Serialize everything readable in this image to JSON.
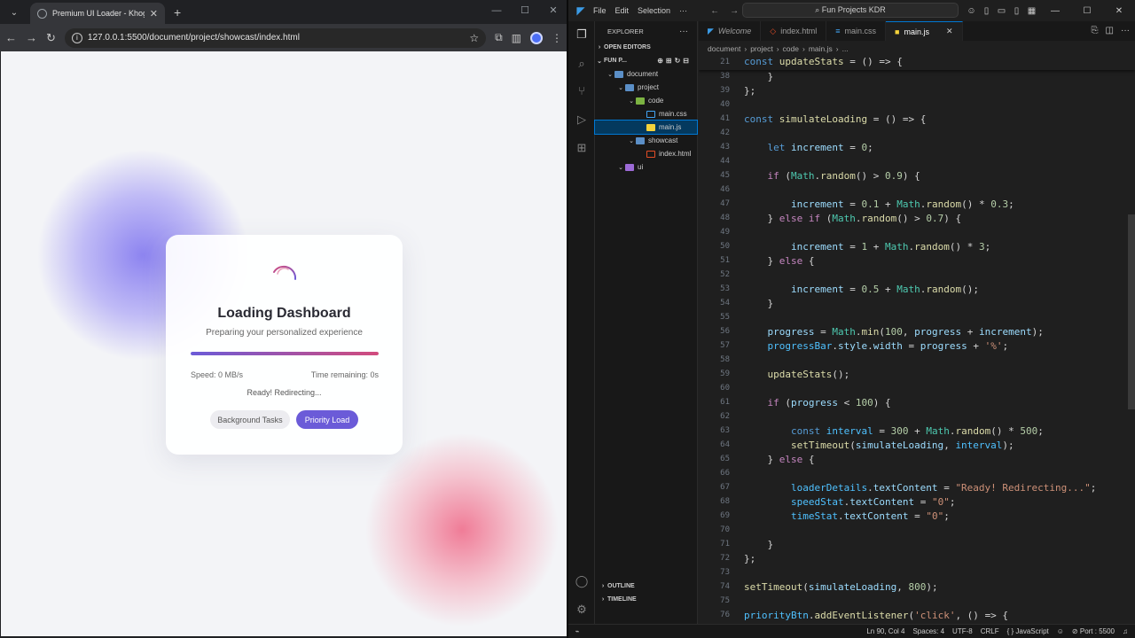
{
  "browser": {
    "tab_title": "Premium UI Loader - Khogendr",
    "url": "127.0.0.1:5500/document/project/showcast/index.html"
  },
  "loader": {
    "title": "Loading Dashboard",
    "subtitle": "Preparing your personalized experience",
    "progress_percent": 100,
    "speed": "Speed: 0 MB/s",
    "time_remaining": "Time remaining: 0s",
    "details": "Ready! Redirecting...",
    "btn_background": "Background Tasks",
    "btn_priority": "Priority Load",
    "accent": "#6b5bd8",
    "accent2": "#d24b7c"
  },
  "vscode": {
    "menu": [
      "File",
      "Edit",
      "Selection",
      "···"
    ],
    "command_center": "Fun Projects KDR",
    "explorer_title": "EXPLORER",
    "open_editors": "OPEN EDITORS",
    "workspace": "FUN P...",
    "tree": [
      {
        "label": "document",
        "type": "folder",
        "depth": 1,
        "open": true
      },
      {
        "label": "project",
        "type": "folder",
        "depth": 2,
        "open": true
      },
      {
        "label": "code",
        "type": "folder-g",
        "depth": 3,
        "open": true
      },
      {
        "label": "main.css",
        "type": "css",
        "depth": 4
      },
      {
        "label": "main.js",
        "type": "js",
        "depth": 4,
        "selected": true
      },
      {
        "label": "showcast",
        "type": "folder",
        "depth": 3,
        "open": true
      },
      {
        "label": "index.html",
        "type": "html",
        "depth": 4
      },
      {
        "label": "ui",
        "type": "folder-u",
        "depth": 2,
        "open": true
      }
    ],
    "outline": "OUTLINE",
    "timeline": "TIMELINE",
    "tabs": [
      {
        "label": "Welcome",
        "icon": "vscode-icon"
      },
      {
        "label": "index.html",
        "icon": "html-icon"
      },
      {
        "label": "main.css",
        "icon": "css-icon"
      },
      {
        "label": "main.js",
        "icon": "js-icon",
        "active": true
      }
    ],
    "breadcrumbs": [
      "document",
      "project",
      "code",
      "main.js",
      "..."
    ],
    "code_lines": [
      {
        "n": "21",
        "html": "<span class='st'>const</span> <span class='fn'>updateStats</span> <span class='op'>=</span> () <span class='op'>=&gt;</span> {"
      },
      {
        "n": "38",
        "html": "    }"
      },
      {
        "n": "39",
        "html": "};"
      },
      {
        "n": "40",
        "html": ""
      },
      {
        "n": "41",
        "html": "<span class='st'>const</span> <span class='fn'>simulateLoading</span> <span class='op'>=</span> () <span class='op'>=&gt;</span> {"
      },
      {
        "n": "42",
        "html": ""
      },
      {
        "n": "43",
        "html": "    <span class='st'>let</span> <span class='vr'>increment</span> <span class='op'>=</span> <span class='nm'>0</span>;"
      },
      {
        "n": "44",
        "html": ""
      },
      {
        "n": "45",
        "html": "    <span class='kw'>if</span> (<span class='ty'>Math</span>.<span class='fn'>random</span>() <span class='op'>&gt;</span> <span class='nm'>0.9</span>) {"
      },
      {
        "n": "46",
        "html": ""
      },
      {
        "n": "47",
        "html": "        <span class='vr'>increment</span> <span class='op'>=</span> <span class='nm'>0.1</span> <span class='op'>+</span> <span class='ty'>Math</span>.<span class='fn'>random</span>() <span class='op'>*</span> <span class='nm'>0.3</span>;"
      },
      {
        "n": "48",
        "html": "    } <span class='kw'>else if</span> (<span class='ty'>Math</span>.<span class='fn'>random</span>() <span class='op'>&gt;</span> <span class='nm'>0.7</span>) {"
      },
      {
        "n": "49",
        "html": ""
      },
      {
        "n": "50",
        "html": "        <span class='vr'>increment</span> <span class='op'>=</span> <span class='nm'>1</span> <span class='op'>+</span> <span class='ty'>Math</span>.<span class='fn'>random</span>() <span class='op'>*</span> <span class='nm'>3</span>;"
      },
      {
        "n": "51",
        "html": "    } <span class='kw'>else</span> {"
      },
      {
        "n": "52",
        "html": ""
      },
      {
        "n": "53",
        "html": "        <span class='vr'>increment</span> <span class='op'>=</span> <span class='nm'>0.5</span> <span class='op'>+</span> <span class='ty'>Math</span>.<span class='fn'>random</span>();"
      },
      {
        "n": "54",
        "html": "    }"
      },
      {
        "n": "55",
        "html": ""
      },
      {
        "n": "56",
        "html": "    <span class='vr'>progress</span> <span class='op'>=</span> <span class='ty'>Math</span>.<span class='fn'>min</span>(<span class='nm'>100</span>, <span class='vr'>progress</span> <span class='op'>+</span> <span class='vr'>increment</span>);"
      },
      {
        "n": "57",
        "html": "    <span class='cn'>progressBar</span>.<span class='vr'>style</span>.<span class='vr'>width</span> <span class='op'>=</span> <span class='vr'>progress</span> <span class='op'>+</span> <span class='sg'>'%'</span>;"
      },
      {
        "n": "58",
        "html": ""
      },
      {
        "n": "59",
        "html": "    <span class='fn'>updateStats</span>();"
      },
      {
        "n": "60",
        "html": ""
      },
      {
        "n": "61",
        "html": "    <span class='kw'>if</span> (<span class='vr'>progress</span> <span class='op'>&lt;</span> <span class='nm'>100</span>) {"
      },
      {
        "n": "62",
        "html": ""
      },
      {
        "n": "63",
        "html": "        <span class='st'>const</span> <span class='cn'>interval</span> <span class='op'>=</span> <span class='nm'>300</span> <span class='op'>+</span> <span class='ty'>Math</span>.<span class='fn'>random</span>() <span class='op'>*</span> <span class='nm'>500</span>;"
      },
      {
        "n": "64",
        "html": "        <span class='fn'>setTimeout</span>(<span class='vr'>simulateLoading</span>, <span class='cn'>interval</span>);"
      },
      {
        "n": "65",
        "html": "    } <span class='kw'>else</span> {"
      },
      {
        "n": "66",
        "html": ""
      },
      {
        "n": "67",
        "html": "        <span class='cn'>loaderDetails</span>.<span class='vr'>textContent</span> <span class='op'>=</span> <span class='sg'>\"Ready! Redirecting...\"</span>;"
      },
      {
        "n": "68",
        "html": "        <span class='cn'>speedStat</span>.<span class='vr'>textContent</span> <span class='op'>=</span> <span class='sg'>\"0\"</span>;"
      },
      {
        "n": "69",
        "html": "        <span class='cn'>timeStat</span>.<span class='vr'>textContent</span> <span class='op'>=</span> <span class='sg'>\"0\"</span>;"
      },
      {
        "n": "70",
        "html": ""
      },
      {
        "n": "71",
        "html": "    }"
      },
      {
        "n": "72",
        "html": "};"
      },
      {
        "n": "73",
        "html": ""
      },
      {
        "n": "74",
        "html": "<span class='fn'>setTimeout</span>(<span class='vr'>simulateLoading</span>, <span class='nm'>800</span>);"
      },
      {
        "n": "75",
        "html": ""
      },
      {
        "n": "76",
        "html": "<span class='cn'>priorityBtn</span>.<span class='fn'>addEventListener</span>(<span class='sg'>'click'</span>, () <span class='op'>=&gt;</span> {"
      }
    ],
    "status": {
      "position": "Ln 90, Col 4",
      "spaces": "Spaces: 4",
      "encoding": "UTF-8",
      "eol": "CRLF",
      "language": "{ } JavaScript",
      "port": "Port : 5500"
    }
  }
}
